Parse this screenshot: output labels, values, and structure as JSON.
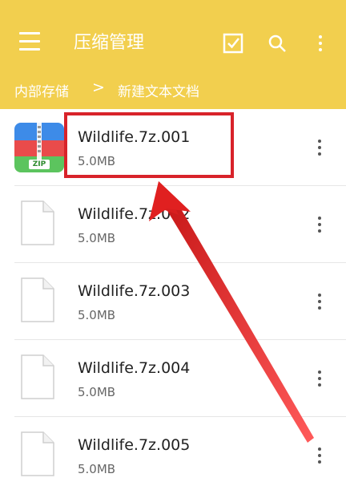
{
  "app": {
    "title": "压缩管理"
  },
  "breadcrumb": {
    "root": "内部存储",
    "separator": ">",
    "current": "新建文本文档"
  },
  "icons": {
    "menu": "hamburger-menu-icon",
    "select": "checkbox-select-icon",
    "search": "search-icon",
    "more": "more-vertical-icon",
    "zip": "zip-archive-icon",
    "file": "document-icon"
  },
  "colors": {
    "appbar": "#f2cf4e",
    "highlight": "#d8232a",
    "arrow": "#e02020"
  },
  "files": [
    {
      "name": "Wildlife.7z.001",
      "size": "5.0MB",
      "type": "zip"
    },
    {
      "name": "Wildlife.7z.002",
      "size": "5.0MB",
      "type": "file"
    },
    {
      "name": "Wildlife.7z.003",
      "size": "5.0MB",
      "type": "file"
    },
    {
      "name": "Wildlife.7z.004",
      "size": "5.0MB",
      "type": "file"
    },
    {
      "name": "Wildlife.7z.005",
      "size": "5.0MB",
      "type": "file"
    }
  ],
  "zip_badge": "ZIP"
}
